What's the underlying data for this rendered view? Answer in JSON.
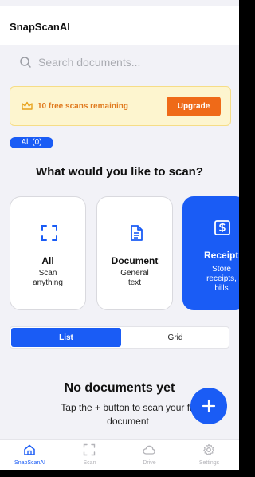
{
  "app": {
    "title": "SnapScanAI"
  },
  "search": {
    "placeholder": "Search documents..."
  },
  "banner": {
    "text": "10 free scans remaining",
    "button": "Upgrade"
  },
  "filter_chip": {
    "label": "All (0)"
  },
  "scan_section": {
    "title": "What would you like to scan?",
    "cards": [
      {
        "title": "All",
        "subtitle_lines": [
          "Scan",
          "anything"
        ],
        "icon": "scan-frame-icon"
      },
      {
        "title": "Document",
        "subtitle_lines": [
          "General",
          "text"
        ],
        "icon": "document-icon"
      },
      {
        "title": "Receipt",
        "subtitle_lines": [
          "Store",
          "receipts,",
          "bills"
        ],
        "icon": "receipt-icon",
        "selected": true
      }
    ]
  },
  "view_toggle": {
    "options": [
      "List",
      "Grid"
    ],
    "selected": "List"
  },
  "empty_state": {
    "title": "No documents yet",
    "subtitle_lines": [
      "Tap the + button to scan your fir",
      "document"
    ]
  },
  "fab": {
    "icon": "plus-icon"
  },
  "tabbar": {
    "tabs": [
      {
        "label": "SnapScanAI",
        "icon": "home-icon",
        "active": true
      },
      {
        "label": "Scan",
        "icon": "scan-frame-icon"
      },
      {
        "label": "Drive",
        "icon": "cloud-icon"
      },
      {
        "label": "Settings",
        "icon": "gear-icon"
      }
    ]
  },
  "colors": {
    "accent": "#1a5cf5",
    "upgrade": "#ef6a18",
    "banner_bg": "#fdf5cf",
    "banner_text": "#e07a1f",
    "background": "#f2f2f7"
  }
}
